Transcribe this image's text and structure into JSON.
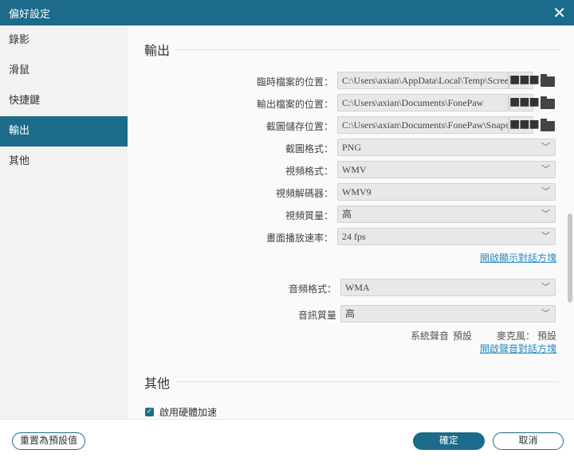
{
  "window": {
    "title": "偏好設定"
  },
  "sidebar": {
    "items": [
      {
        "label": "錄影"
      },
      {
        "label": "滑鼠"
      },
      {
        "label": "快捷鍵"
      },
      {
        "label": "輸出"
      },
      {
        "label": "其他"
      }
    ]
  },
  "output": {
    "heading": "輸出",
    "temp_label": "臨時檔案的位置：",
    "temp_value": "C:\\Users\\axian\\AppData\\Local\\Temp\\Screen",
    "out_label": "輸出檔案的位置：",
    "out_value": "C:\\Users\\axian\\Documents\\FonePaw",
    "snap_label": "截圖儲存位置：",
    "snap_value": "C:\\Users\\axian\\Documents\\FonePaw\\Snapshot",
    "browse": "■■■",
    "shot_format_label": "截圖格式：",
    "shot_format": "PNG",
    "video_format_label": "視頻格式：",
    "video_format": "WMV",
    "codec_label": "視頻解碼器：",
    "codec": "WMV9",
    "quality_label": "視頻質量：",
    "quality": "高",
    "fps_label": "畫面播放速率：",
    "fps": "24 fps",
    "display_link": "開啟顯示對話方塊",
    "audio_format_label": "音頻格式：",
    "audio_format": "WMA",
    "audio_quality_label": "音訊質量",
    "audio_quality": "高",
    "system_sound_label": "系統聲音",
    "system_sound_value": "預設",
    "mic_label": "麥克風：",
    "mic_value": "預設",
    "sound_link": "開啟聲音對話方塊"
  },
  "other": {
    "heading": "其他",
    "hw_accel": "啟用硬體加速"
  },
  "footer": {
    "reset": "重置為預設值",
    "ok": "確定",
    "cancel": "取消"
  }
}
